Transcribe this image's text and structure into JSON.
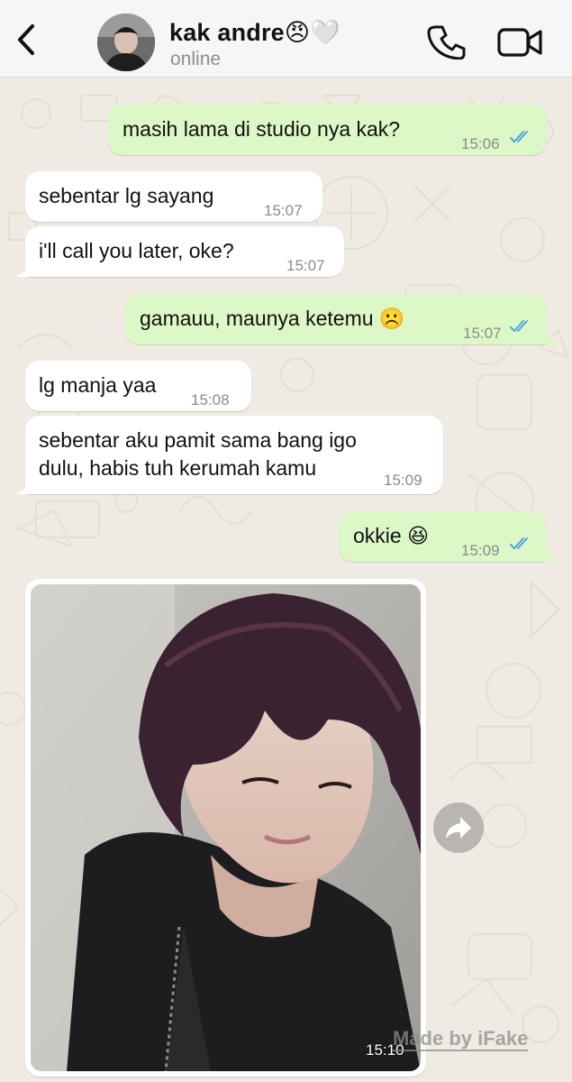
{
  "header": {
    "contact_name": "kak andre😠🤍",
    "status": "online"
  },
  "messages": [
    {
      "direction": "out",
      "text": "masih lama di studio nya kak?",
      "time": "15:06",
      "read": true
    },
    {
      "direction": "in",
      "text": "sebentar lg sayang",
      "time": "15:07"
    },
    {
      "direction": "in",
      "text": "i'll call you later, oke?",
      "time": "15:07"
    },
    {
      "direction": "out",
      "text": "gamauu, maunya ketemu ☹️",
      "time": "15:07",
      "read": true
    },
    {
      "direction": "in",
      "text": "lg manja yaa",
      "time": "15:08"
    },
    {
      "direction": "in",
      "text_line1": "sebentar aku pamit sama bang igo",
      "text_line2": "dulu, habis tuh kerumah kamu",
      "time": "15:09"
    },
    {
      "direction": "out",
      "text": "okkie 😆",
      "time": "15:09",
      "read": true
    },
    {
      "direction": "in",
      "type": "photo",
      "time": "15:10"
    }
  ],
  "watermark": "Made by iFake",
  "colors": {
    "outgoing_bubble": "#dcf8c6",
    "incoming_bubble": "#ffffff",
    "read_ticks": "#4fa3e0",
    "background": "#efeae2"
  },
  "icons": {
    "back": "chevron-left-icon",
    "call": "phone-icon",
    "video": "video-camera-icon",
    "forward": "share-forward-icon"
  }
}
